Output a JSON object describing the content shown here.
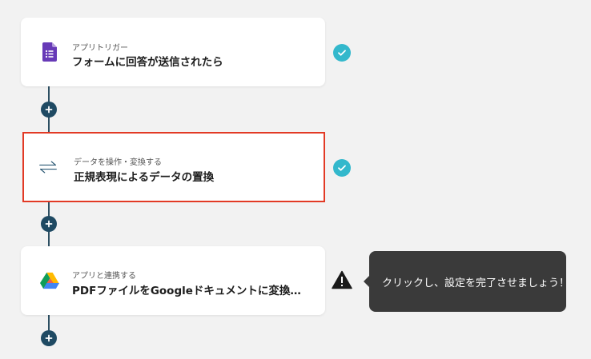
{
  "flow": {
    "steps": [
      {
        "subtitle": "アプリトリガー",
        "title": "フォームに回答が送信されたら",
        "icon": "google-forms-icon",
        "status": "complete"
      },
      {
        "subtitle": "データを操作・変換する",
        "title": "正規表現によるデータの置換",
        "icon": "swap-arrows-icon",
        "status": "complete",
        "highlighted": true
      },
      {
        "subtitle": "アプリと連携する",
        "title": "PDFファイルをGoogleドキュメントに変換…",
        "icon": "google-drive-icon",
        "status": "warning"
      }
    ],
    "tooltip": "クリックし、設定を完了させましょう！"
  },
  "colors": {
    "background": "#f2f2f2",
    "connector": "#1f4a63",
    "check": "#33b8cc",
    "highlight_border": "#e23a25",
    "tooltip_bg": "#3a3a3a"
  }
}
